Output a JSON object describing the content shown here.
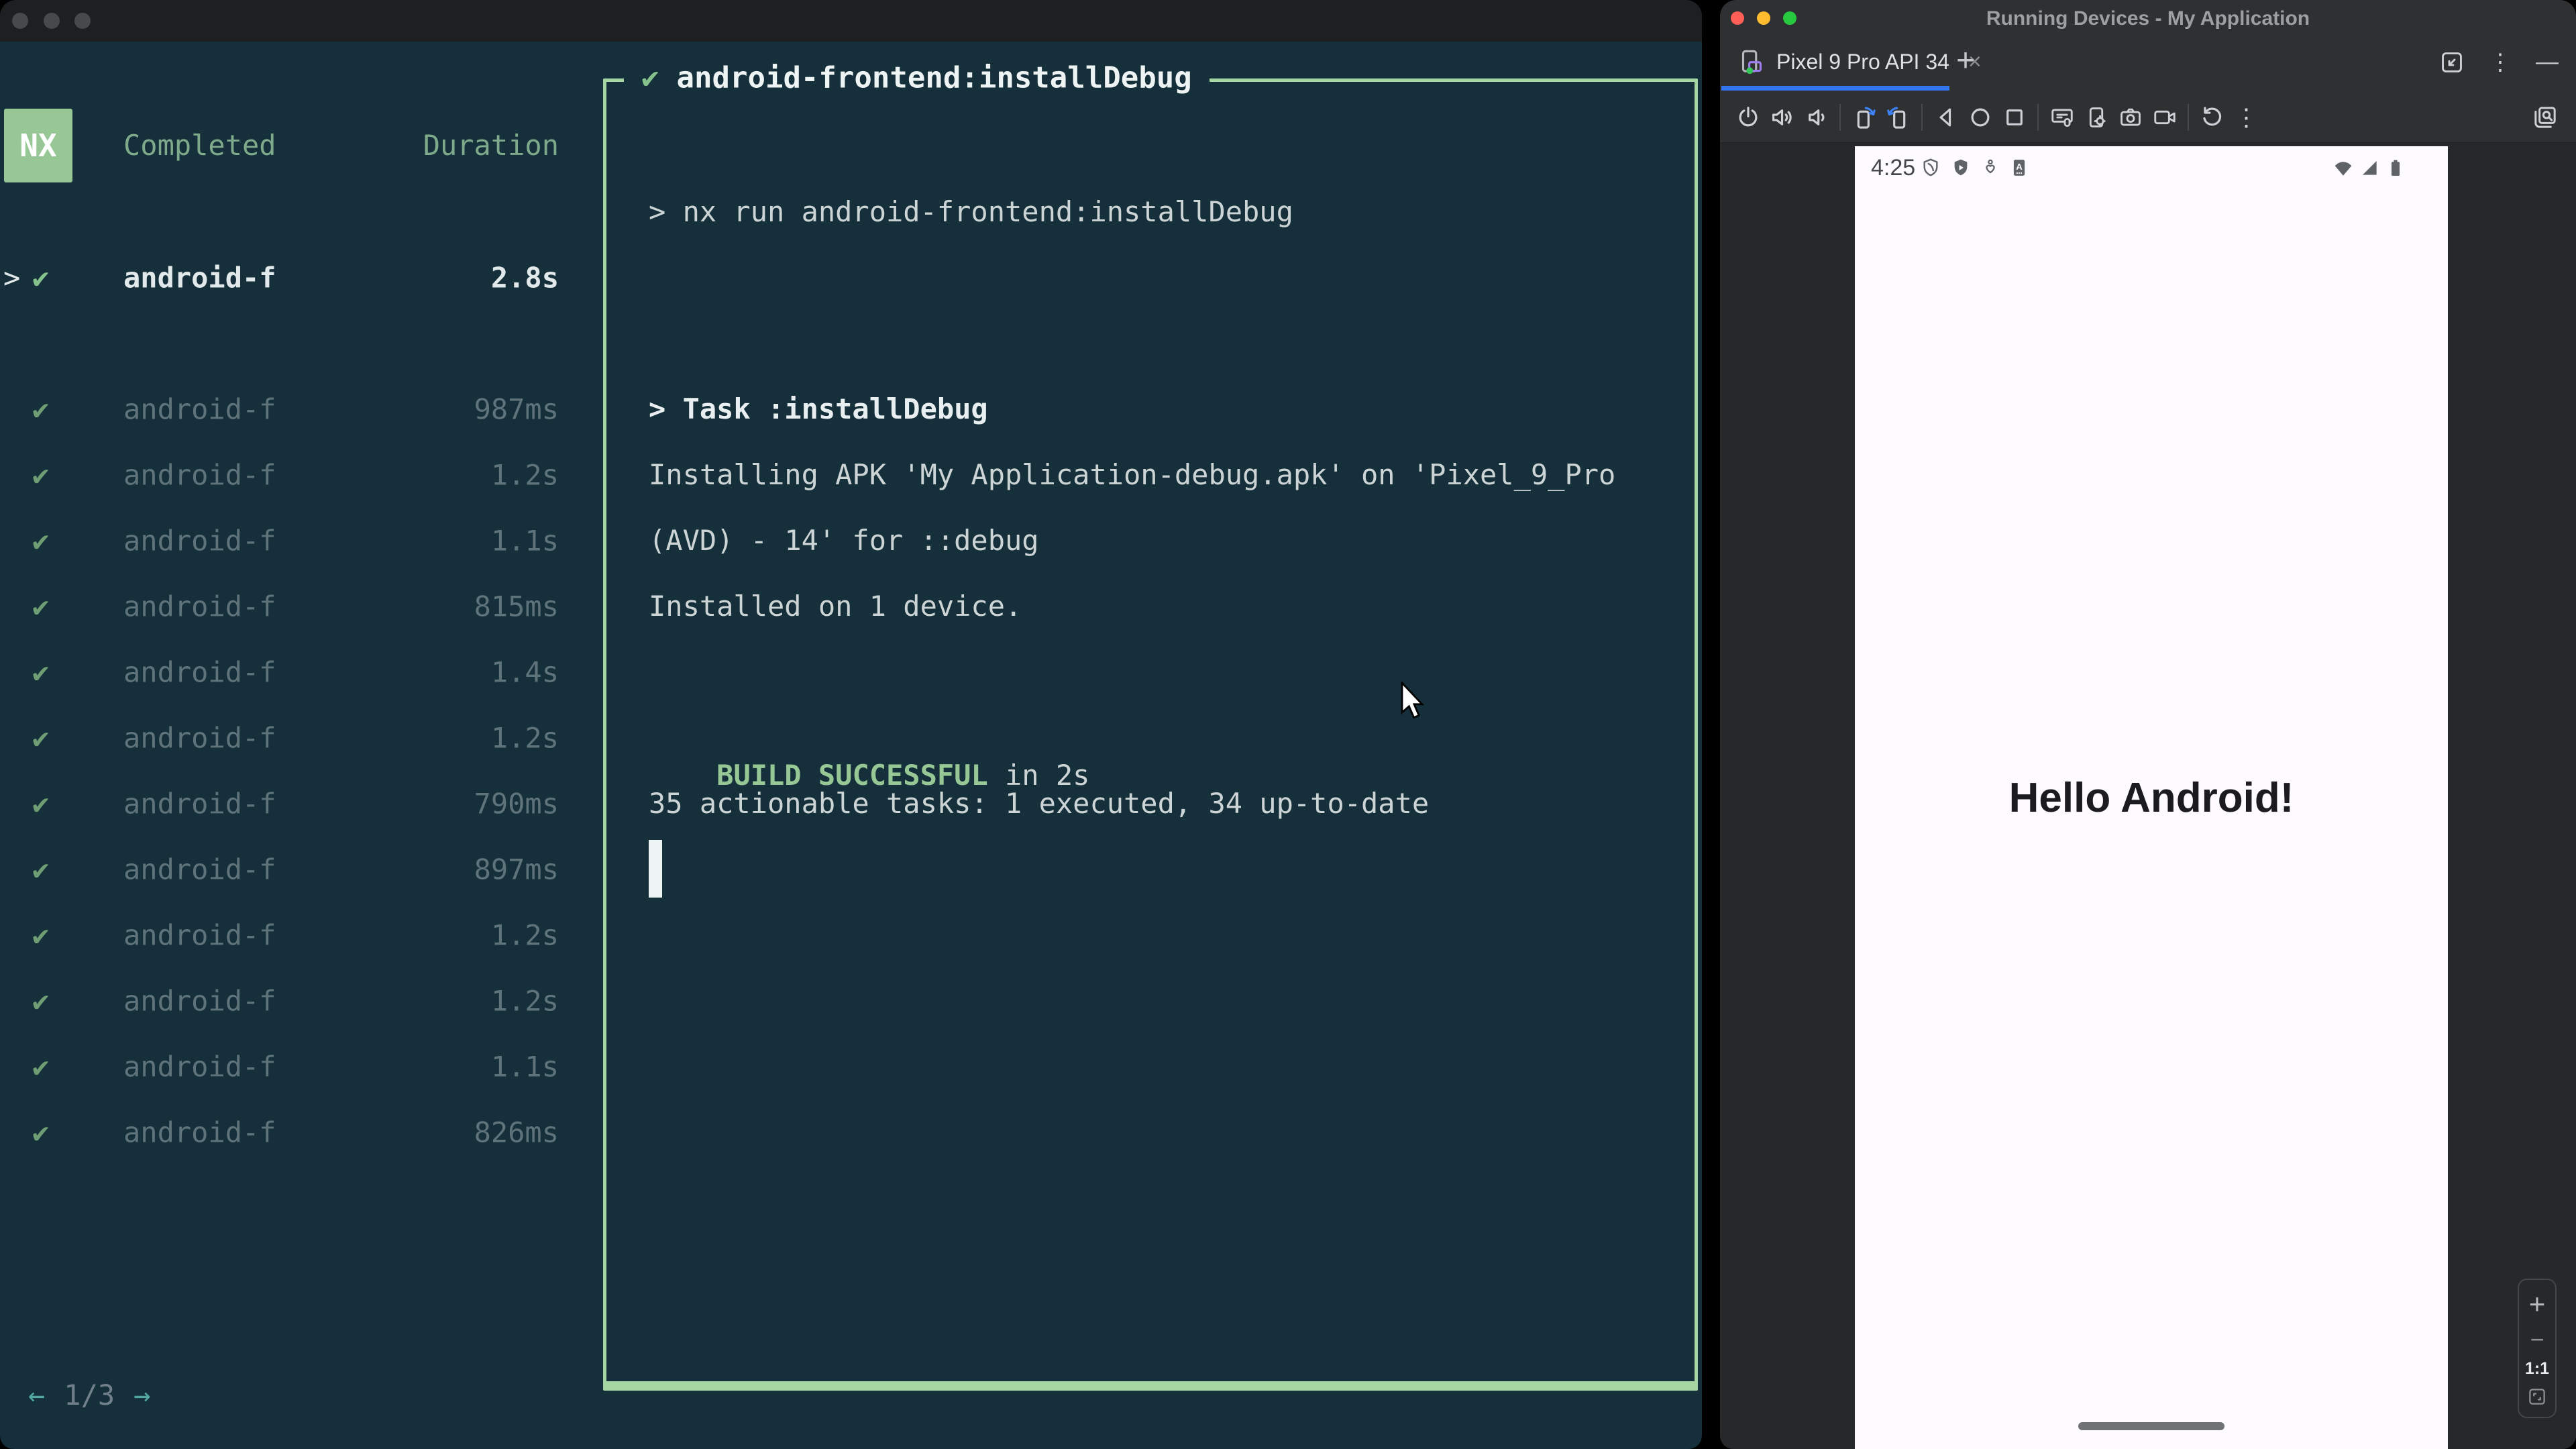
{
  "terminal_window": {
    "nx_logo": "NX",
    "columns": {
      "completed": "Completed",
      "duration": "Duration"
    },
    "selected_task": {
      "caret": ">",
      "check": "✔",
      "name": "android-f",
      "duration": "2.8s"
    },
    "tasks": [
      {
        "check": "✔",
        "name": "android-f",
        "duration": "987ms"
      },
      {
        "check": "✔",
        "name": "android-f",
        "duration": "1.2s"
      },
      {
        "check": "✔",
        "name": "android-f",
        "duration": "1.1s"
      },
      {
        "check": "✔",
        "name": "android-f",
        "duration": "815ms"
      },
      {
        "check": "✔",
        "name": "android-f",
        "duration": "1.4s"
      },
      {
        "check": "✔",
        "name": "android-f",
        "duration": "1.2s"
      },
      {
        "check": "✔",
        "name": "android-f",
        "duration": "790ms"
      },
      {
        "check": "✔",
        "name": "android-f",
        "duration": "897ms"
      },
      {
        "check": "✔",
        "name": "android-f",
        "duration": "1.2s"
      },
      {
        "check": "✔",
        "name": "android-f",
        "duration": "1.2s"
      },
      {
        "check": "✔",
        "name": "android-f",
        "duration": "1.1s"
      },
      {
        "check": "✔",
        "name": "android-f",
        "duration": "826ms"
      }
    ],
    "pagination": {
      "prev_arrow": "←",
      "page_label": "1/3",
      "next_arrow": "→"
    },
    "output": {
      "header_check": "✔",
      "header_title": "android-frontend:installDebug",
      "command_line": "> nx run android-frontend:installDebug",
      "task_header": "> Task :installDebug",
      "log_line_1": "Installing APK 'My Application-debug.apk' on 'Pixel_9_Pro",
      "log_line_2": "(AVD) - 14' for ::debug",
      "log_line_3": "Installed on 1 device.",
      "build_status": "BUILD SUCCESSFUL",
      "build_time": " in 2s",
      "summary_line": "35 actionable tasks: 1 executed, 34 up-to-date"
    },
    "colors": {
      "background": "#15303a",
      "accent_green": "#a6d7a2",
      "badge_green": "#96c795",
      "teal_arrow": "#53a8a2"
    }
  },
  "studio_window": {
    "titlebar": {
      "title": "Running Devices - My Application"
    },
    "tabbar": {
      "tab_label": "Pixel 9 Pro API 34",
      "close_glyph": "×",
      "new_tab_glyph": "+",
      "more_glyph": "⋮",
      "minimize_glyph": "—"
    },
    "toolbar": {
      "icons": [
        "power",
        "volume-up",
        "volume-down",
        "rotate-left",
        "rotate-right",
        "back",
        "home",
        "overview",
        "screenshot",
        "device-settings",
        "camera",
        "screen-record",
        "reset",
        "more",
        "screen-search"
      ],
      "more_glyph": "⋮"
    },
    "emulator": {
      "status_time": "4:25",
      "status_icons": [
        "vpn-shield",
        "protected-shield",
        "accessibility",
        "app-badge",
        "wifi",
        "cellular-signal",
        "battery"
      ],
      "hello_text": "Hello Android!",
      "zoom_controls": {
        "zoom_in": "+",
        "zoom_out": "−",
        "scale_label": "1:1"
      }
    },
    "colors": {
      "chrome": "#2e3032",
      "accent_blue": "#3574f0",
      "screen": "#fdfbff"
    }
  }
}
